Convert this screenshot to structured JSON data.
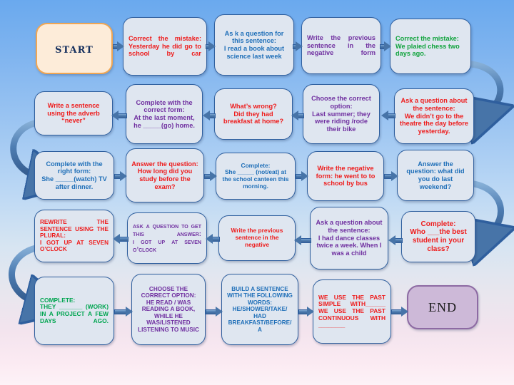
{
  "board": {
    "title": "Past Simple / Past Continuous board game",
    "start_label": "START",
    "end_label": "END",
    "accent_colors": {
      "red": "#ee1c1c",
      "blue": "#1f6fb8",
      "purple": "#7030a0",
      "green": "#10a33c",
      "start_fill": "#fdecd9",
      "start_border": "#f0a653",
      "end_fill": "#cdb9d8",
      "end_border": "#8d6aa3",
      "card_fill": "#dfe6f0",
      "card_border": "#2f5f9e",
      "arrow": "#4774a8"
    }
  },
  "cells": [
    {
      "id": "r1c1",
      "text": "Correct the mistake:\nYesterday he did go to school by car",
      "color": "red"
    },
    {
      "id": "r1c2",
      "text": "As k a question for this sentence:\nI read  a book about science last week",
      "color": "blue"
    },
    {
      "id": "r1c3",
      "text": "Write the previous sentence in the negative form",
      "color": "purple"
    },
    {
      "id": "r1c4",
      "text": "Correct the mistake:\nWe plaied chess  two days ago.",
      "color": "green"
    },
    {
      "id": "r2c1",
      "text": "Write a sentence using the adverb “never”",
      "color": "red"
    },
    {
      "id": "r2c2",
      "text": "Complete with the correct form:\nAt the last moment, he _____(go) home.",
      "color": "purple"
    },
    {
      "id": "r2c3",
      "text": "What’s wrong?\nDid they had breakfast at home?",
      "color": "red"
    },
    {
      "id": "r2c4",
      "text": "Choose the correct option:\nLast summer; they were riding /rode their bike",
      "color": "purple"
    },
    {
      "id": "r2c5",
      "text": "Ask a question about the sentence:\nWe didn’t go to the theatre the day before yesterday.",
      "color": "red"
    },
    {
      "id": "r3c1",
      "text": "Complete with the right form:\nShe  _____(watch) TV after dinner.",
      "color": "blue"
    },
    {
      "id": "r3c2",
      "text": "Answer the question:\nHow long did you study  before the exam?",
      "color": "red"
    },
    {
      "id": "r3c3",
      "text": "Complete:\nShe _____ (not/eat) at the school canteen this morning.",
      "color": "blue"
    },
    {
      "id": "r3c4",
      "text": "Write the negative form: he went to to school by bus",
      "color": "red"
    },
    {
      "id": "r3c5",
      "text": "Answer the question: what did you do last weekend?",
      "color": "blue"
    },
    {
      "id": "r4c1",
      "text": "REWRITE THE SENTENCE USING THE PLURAL:\nI GOT UP AT SEVEN O’CLOCK",
      "color": "red"
    },
    {
      "id": "r4c2",
      "text": "Ask a question to get this answer:\nI got up at seven o’clock",
      "color": "purple"
    },
    {
      "id": "r4c3",
      "text": "Write the previous sentence in the negative",
      "color": "red"
    },
    {
      "id": "r4c4",
      "text": "Ask a question about the sentence:\nI had dance classes twice a week. When I was a child",
      "color": "purple"
    },
    {
      "id": "r4c5",
      "text": "Complete:\nWho ___the best student in your class?",
      "color": "red"
    },
    {
      "id": "r5c1",
      "text": "COMPLETE:\nTHEY _______ (WORK) IN A PROJECT A FEW DAYS AGO.",
      "color": "green"
    },
    {
      "id": "r5c2",
      "text": "CHOOSE THE CORRECT OPTION:\nHE READ / WAS READING A BOOK, WHILE HE WAS/LISTENED LISTENING TO MUSIC",
      "color": "purple"
    },
    {
      "id": "r5c3",
      "text": "BUILD A SENTENCE WITH THE FOLLOWING WORDS:\nHE/SHOWER/TAKE/ HAD BREAKFAST/BEFORE/ A",
      "color": "blue"
    },
    {
      "id": "r5c4",
      "text": "WE USE THE PAST SIMPLE WITH______\nWE USE THE PAST CONTINUOUS WITH ________",
      "color": "red"
    }
  ]
}
